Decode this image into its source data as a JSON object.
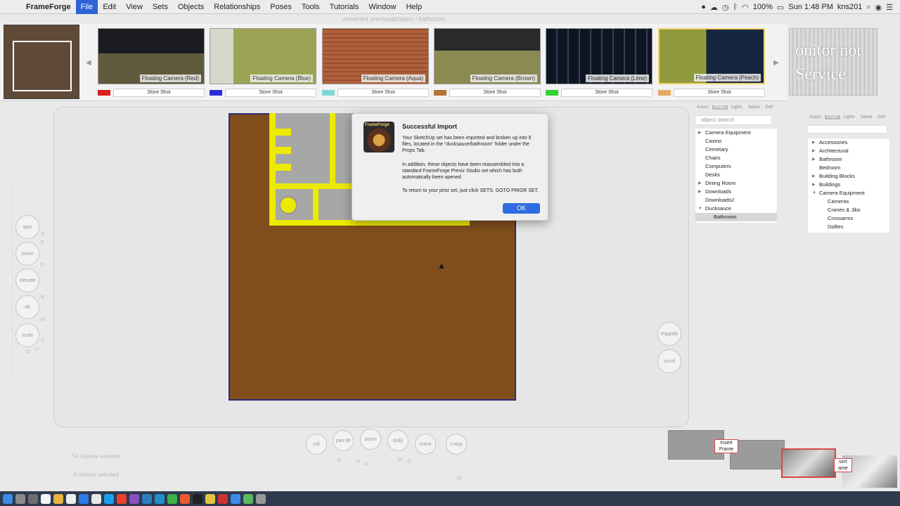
{
  "menubar": {
    "app": "FrameForge",
    "items": [
      "File",
      "Edit",
      "View",
      "Sets",
      "Objects",
      "Relationships",
      "Poses",
      "Tools",
      "Tutorials",
      "Window",
      "Help"
    ],
    "active": "File",
    "battery": "100%",
    "clock": "Sun 1:48 PM",
    "user": "kns201"
  },
  "window": {
    "title": "unnamed previsualization / bathroom"
  },
  "shots": [
    {
      "label": "Floating Camera (Red)",
      "store": "Store Shot",
      "color": "#d81e1e"
    },
    {
      "label": "Floating Camera (Blue)",
      "store": "Store Shot",
      "color": "#2e2edc"
    },
    {
      "label": "Floating Camera (Aqua)",
      "store": "Store Shot",
      "color": "#7fd6d6"
    },
    {
      "label": "Floating Camera (Brown)",
      "store": "Store Shot",
      "color": "#b27536"
    },
    {
      "label": "Floating Camera (Lime)",
      "store": "Store Shot",
      "color": "#35d035"
    },
    {
      "label": "Floating Camera (Peach)",
      "store": "Store Shot",
      "color": "#e7a963"
    }
  ],
  "monitor": {
    "line1": "onitor not",
    "line2": "Service"
  },
  "dialog": {
    "title": "Successful Import",
    "icon_text": "FrameForge",
    "p1": "Your SketchUp set has been imported and broken up into 9 files, located in the \"ducksauce/bathroom\" folder under the Props Tab.",
    "p2": "In addition, these objects have been reassembled into a standard FrameForge Previz Studio set which has both automatically been opened.",
    "p3": "To return to your prior set, just click SETS, GOTO PRIOR SET.",
    "ok": "OK"
  },
  "left_controls": [
    {
      "label": "spin"
    },
    {
      "label": "move"
    },
    {
      "label": "elevate"
    },
    {
      "label": "tilt"
    },
    {
      "label": "scale"
    }
  ],
  "left_letters": [
    "R",
    "P",
    "D",
    "R",
    "M",
    "D",
    "W",
    "D"
  ],
  "right_controls": [
    "magnify",
    "scroll"
  ],
  "bottom_controls": [
    "roll",
    "pan tilt",
    "zoom",
    "dolly",
    "crane",
    "f-stop"
  ],
  "bottom_letters": [
    "R",
    "M",
    "D",
    "M",
    "D",
    "W"
  ],
  "selection": {
    "line1": "54 objects selected",
    "line2": "0 objects selected"
  },
  "props_panel": {
    "tabs": [
      "Actors",
      "Props",
      "Lights",
      "Select",
      "DoF"
    ],
    "active_tab": "Props",
    "search_placeholder": "object search",
    "items": [
      {
        "label": "Camera Equipment",
        "level": 0,
        "arrow": "right"
      },
      {
        "label": "Casino",
        "level": 0,
        "arrow": ""
      },
      {
        "label": "Cemetary",
        "level": 0,
        "arrow": ""
      },
      {
        "label": "Chairs",
        "level": 0,
        "arrow": ""
      },
      {
        "label": "Computers",
        "level": 0,
        "arrow": ""
      },
      {
        "label": "Desks",
        "level": 0,
        "arrow": ""
      },
      {
        "label": "Dining Room",
        "level": 0,
        "arrow": "right"
      },
      {
        "label": "Downloads",
        "level": 0,
        "arrow": "right"
      },
      {
        "label": "Downloads2",
        "level": 0,
        "arrow": ""
      },
      {
        "label": "Ducksauce",
        "level": 0,
        "arrow": "down"
      },
      {
        "label": "Bathroom",
        "level": 1,
        "arrow": "",
        "selected": true
      }
    ]
  },
  "props_panel2": {
    "tabs": [
      "Actors",
      "Props",
      "Lights",
      "Select",
      "DoF"
    ],
    "active_tab": "Props",
    "items": [
      {
        "label": "Accessories",
        "level": 0,
        "arrow": "right"
      },
      {
        "label": "Architectural",
        "level": 0,
        "arrow": "right"
      },
      {
        "label": "Bathroom",
        "level": 0,
        "arrow": "right"
      },
      {
        "label": "Bedroom",
        "level": 0,
        "arrow": ""
      },
      {
        "label": "Building Blocks",
        "level": 0,
        "arrow": "right"
      },
      {
        "label": "Buildings",
        "level": 0,
        "arrow": "right"
      },
      {
        "label": "Camera Equipment",
        "level": 0,
        "arrow": "down"
      },
      {
        "label": "Cameras",
        "level": 1,
        "arrow": ""
      },
      {
        "label": "Cranes & Jibs",
        "level": 1,
        "arrow": ""
      },
      {
        "label": "Crossarms",
        "level": 1,
        "arrow": ""
      },
      {
        "label": "Dollies",
        "level": 1,
        "arrow": ""
      }
    ]
  },
  "insert_frame": {
    "label": "Insert Frame",
    "label2": "sert ame"
  },
  "colors": {
    "floor": "#7f4e1c",
    "wall": "#ebea00",
    "accent": "#2f6ce0"
  }
}
